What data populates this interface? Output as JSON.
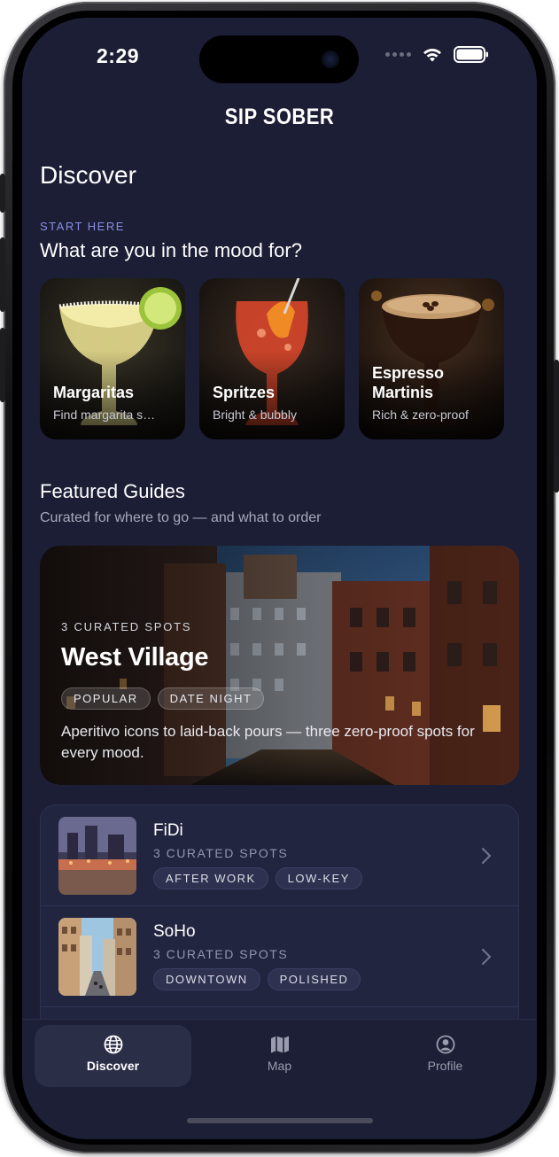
{
  "status_bar": {
    "time": "2:29"
  },
  "app": {
    "title": "SIP SOBER"
  },
  "page": {
    "title": "Discover"
  },
  "mood_section": {
    "eyebrow": "START HERE",
    "question": "What are you in the mood for?",
    "cards": [
      {
        "title": "Margaritas",
        "subtitle": "Find margarita s…"
      },
      {
        "title": "Spritzes",
        "subtitle": "Bright & bubbly"
      },
      {
        "title": "Espresso Martinis",
        "subtitle": "Rich & zero-proof"
      }
    ]
  },
  "featured": {
    "title": "Featured Guides",
    "subtitle": "Curated for where to go — and what to order",
    "hero": {
      "eyebrow": "3 CURATED SPOTS",
      "title": "West Village",
      "tags": [
        "POPULAR",
        "DATE NIGHT"
      ],
      "description": "Aperitivo icons to laid-back pours — three zero-proof spots for every mood."
    },
    "list": [
      {
        "title": "FiDi",
        "subtitle": "3 CURATED SPOTS",
        "tags": [
          "AFTER WORK",
          "LOW-KEY"
        ]
      },
      {
        "title": "SoHo",
        "subtitle": "3 CURATED SPOTS",
        "tags": [
          "DOWNTOWN",
          "POLISHED"
        ]
      }
    ]
  },
  "tabbar": {
    "active": "Discover",
    "tabs": [
      {
        "label": "Discover",
        "icon": "globe-icon"
      },
      {
        "label": "Map",
        "icon": "map-icon"
      },
      {
        "label": "Profile",
        "icon": "profile-icon"
      }
    ]
  },
  "colors": {
    "background": "#1b1e35",
    "accent": "#8b8fe6",
    "card": "#222540"
  }
}
